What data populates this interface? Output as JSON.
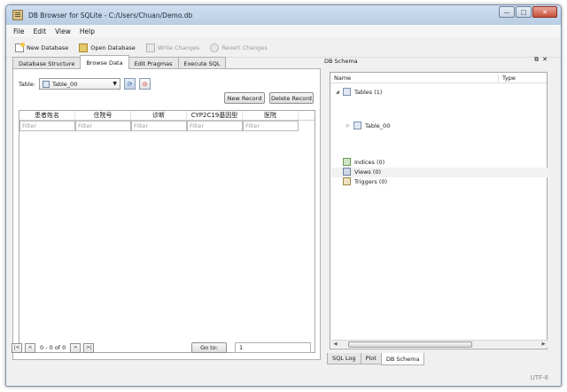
{
  "window": {
    "title": "DB Browser for SQLite - C:/Users/Chuan/Demo.db"
  },
  "window_controls": {
    "minimize": "—",
    "maximize": "□",
    "close": "✕"
  },
  "menu": {
    "items": [
      "File",
      "Edit",
      "View",
      "Help"
    ]
  },
  "toolbar": {
    "new_database": "New Database",
    "open_database": "Open Database",
    "write_changes": "Write Changes",
    "revert_changes": "Revert Changes"
  },
  "tabs": [
    "Database Structure",
    "Browse Data",
    "Edit Pragmas",
    "Execute SQL"
  ],
  "browse": {
    "table_label": "Table:",
    "selected_table": "Table_00",
    "new_record": "New Record",
    "delete_record": "Delete Record",
    "columns": [
      "患者姓名",
      "住院号",
      "诊断",
      "CYP2C19基因型",
      "医院"
    ],
    "filter_placeholder": "Filter",
    "nav": {
      "first": "|<",
      "prev": "<",
      "count": "0 - 0 of 0",
      "next": ">",
      "last": ">|",
      "goto": "Go to:",
      "goto_value": "1"
    }
  },
  "schema": {
    "dock_title": "DB Schema",
    "dock_controls": {
      "float": "⧉",
      "close": "✕"
    },
    "col_name": "Name",
    "col_type": "Type",
    "tables": "Tables (1)",
    "table_00": "Table_00",
    "indices": "Indices (0)",
    "views": "Views (0)",
    "triggers": "Triggers (0)"
  },
  "bottom_tabs": [
    "SQL Log",
    "Plot",
    "DB Schema"
  ],
  "status": {
    "encoding": "UTF-8"
  }
}
